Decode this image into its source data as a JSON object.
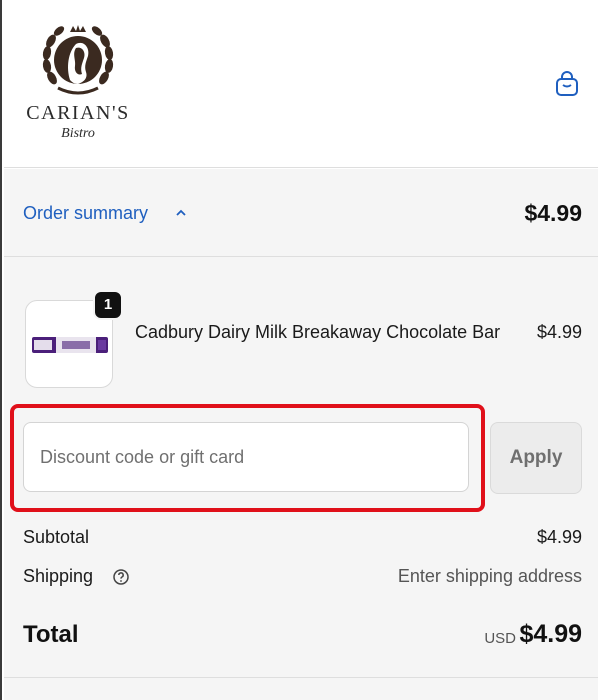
{
  "brand": {
    "name": "CARIAN'S",
    "subtitle": "Bistro",
    "logo_icon": "laurel-wreath-portrait-logo"
  },
  "header": {
    "cart_icon": "shopping-bag-icon"
  },
  "order_summary": {
    "toggle_label": "Order summary",
    "toggle_icon": "chevron-up-icon",
    "total": "$4.99",
    "link_color": "#1f5fbf"
  },
  "line_items": [
    {
      "name": "Cadbury Dairy Milk Breakaway Chocolate Bar",
      "quantity": "1",
      "price": "$4.99"
    }
  ],
  "discount": {
    "placeholder": "Discount code or gift card",
    "value": "",
    "apply_label": "Apply",
    "highlight_color": "#e0101a"
  },
  "totals": {
    "subtotal_label": "Subtotal",
    "subtotal_value": "$4.99",
    "shipping_label": "Shipping",
    "shipping_help_icon": "question-circle-icon",
    "shipping_value": "Enter shipping address",
    "total_label": "Total",
    "currency": "USD",
    "total_value": "$4.99"
  }
}
